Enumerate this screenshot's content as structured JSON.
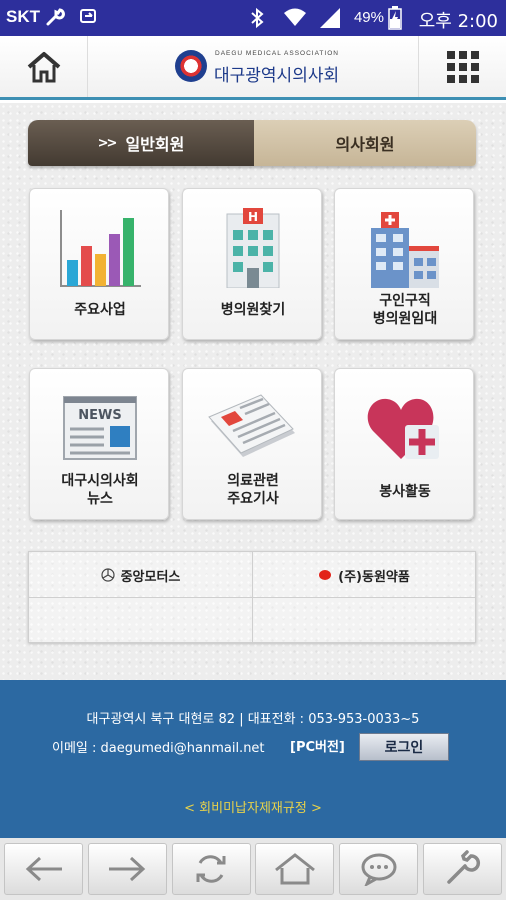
{
  "status_bar": {
    "carrier": "SKT",
    "battery": "49%",
    "time": "오후 2:00"
  },
  "header": {
    "logo_en": "DAEGU MEDICAL ASSOCIATION",
    "logo_kr": "대구광역시의사회"
  },
  "tabs": [
    {
      "label": "일반회원",
      "prefix": ">>",
      "active": true
    },
    {
      "label": "의사회원",
      "active": false
    }
  ],
  "tiles": [
    {
      "label": "주요사업",
      "icon": "bar-chart-icon"
    },
    {
      "label": "병의원찾기",
      "icon": "hospital-icon"
    },
    {
      "label_line1": "구인구직",
      "label_line2": "병의원임대",
      "icon": "buildings-icon"
    },
    {
      "label_line1": "대구시의사회",
      "label_line2": "뉴스",
      "icon": "news-icon",
      "news_text": "NEWS"
    },
    {
      "label_line1": "의료관련",
      "label_line2": "주요기사",
      "icon": "newspaper-icon"
    },
    {
      "label": "봉사활동",
      "icon": "heart-plus-icon"
    }
  ],
  "sponsors": [
    {
      "label": "중앙모터스",
      "icon": "mercedes-logo-icon"
    },
    {
      "label": "(주)동원약품",
      "icon": "dongwon-logo-icon"
    }
  ],
  "footer": {
    "address": "대구광역시 북구 대현로 82 | 대표전화 : 053-953-0033~5",
    "email": "이메일 : daegumedi@hanmail.net",
    "pc_version": "[PC버전]",
    "login": "로그인",
    "policy": "< 회비미납자제재규정 >"
  },
  "toolbar": [
    "back-arrow-icon",
    "forward-arrow-icon",
    "refresh-icon",
    "home-icon",
    "chat-bubble-icon",
    "wrench-icon"
  ],
  "colors": {
    "status_bar": "#2d2f9c",
    "footer": "#2c69a2",
    "tab_active": "#4f453b",
    "tab_inactive": "#d3c5a9",
    "policy_link": "#e8d24a"
  }
}
